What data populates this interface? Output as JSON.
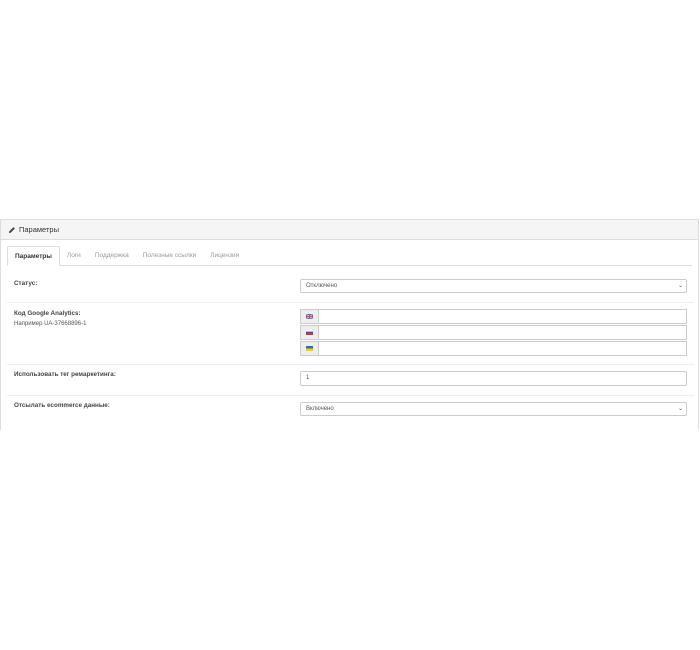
{
  "panel": {
    "title": "Параметры",
    "title_icon": "pencil-icon"
  },
  "tabs": [
    {
      "label": "Параметры",
      "active": true
    },
    {
      "label": "Логи",
      "active": false
    },
    {
      "label": "Поддержка",
      "active": false
    },
    {
      "label": "Полезные ссылки",
      "active": false
    },
    {
      "label": "Лицензия",
      "active": false
    }
  ],
  "form": {
    "status": {
      "label": "Статус:",
      "value": "Отключено"
    },
    "ga_code": {
      "label": "Код Google Analytics:",
      "help": "Например UA-37668896-1",
      "languages": [
        {
          "flag": "en-flag-icon",
          "value": ""
        },
        {
          "flag": "ru-flag-icon",
          "value": ""
        },
        {
          "flag": "ua-flag-icon",
          "value": ""
        }
      ]
    },
    "remarketing": {
      "label": "Использовать тег ремаркетинга:",
      "value": "1"
    },
    "ecommerce": {
      "label": "Отсылать ecommerce данные:",
      "value": "Включено"
    }
  },
  "colors": {
    "border": "#dddddd",
    "heading_bg": "#f5f5f5",
    "addon_bg": "#eeeeee"
  }
}
